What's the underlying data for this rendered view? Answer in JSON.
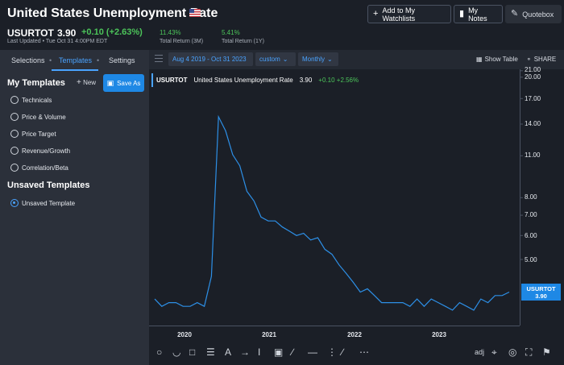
{
  "header": {
    "title": "United States Unemployment Rate",
    "ticker": "USURTOT",
    "price": "3.90",
    "change": "+0.10",
    "change_pct": "(+2.63%)",
    "last_updated": "Last Updated • Tue Oct 31 4:00PM EDT",
    "stats": [
      {
        "value": "11.43%",
        "label": "Total Return (3M)"
      },
      {
        "value": "5.41%",
        "label": "Total Return (1Y)"
      }
    ],
    "buttons": {
      "watchlist": "Add to My Watchlists",
      "notes": "My Notes",
      "quotebox": "Quotebox"
    }
  },
  "sidebar": {
    "tabs": [
      "Selections",
      "Templates",
      "Settings"
    ],
    "active_tab": "Templates",
    "my_templates_title": "My Templates",
    "new_label": "New",
    "save_as_label": "Save As",
    "templates": [
      "Technicals",
      "Price & Volume",
      "Price Target",
      "Revenue/Growth",
      "Correlation/Beta"
    ],
    "unsaved_title": "Unsaved Templates",
    "unsaved_items": [
      "Unsaved Template"
    ]
  },
  "toolbar": {
    "date_range": "Aug 4 2019 - Oct 31 2023",
    "range_mode": "custom",
    "frequency": "Monthly",
    "show_table": "Show Table",
    "share": "SHARE"
  },
  "legend": {
    "symbol": "USURTOT",
    "name": "United States Unemployment Rate",
    "value": "3.90",
    "change": "+0.10",
    "change_pct": "+2.56%"
  },
  "last_label": {
    "symbol": "USURTOT",
    "value": "3.90"
  },
  "bottom_tools": {
    "adj_label": "adj"
  },
  "colors": {
    "accent": "#1e88e5",
    "series": "#2d8fe6",
    "positive": "#4cc45a",
    "background": "#1b1f27",
    "panel": "#2b303a"
  },
  "chart_data": {
    "type": "line",
    "x_label_ticks": [
      "2020",
      "2021",
      "2022",
      "2023"
    ],
    "y_tick_labels": [
      "21.00",
      "20.00",
      "17.00",
      "14.00",
      "11.00",
      "8.00",
      "7.00",
      "6.00",
      "5.00"
    ],
    "y_scale": "log",
    "ylim": [
      3.0,
      21.0
    ],
    "xlim": [
      "2019-08",
      "2023-10"
    ],
    "series": [
      {
        "name": "USURTOT",
        "x": [
          "2019-08",
          "2019-09",
          "2019-10",
          "2019-11",
          "2019-12",
          "2020-01",
          "2020-02",
          "2020-03",
          "2020-04",
          "2020-05",
          "2020-06",
          "2020-07",
          "2020-08",
          "2020-09",
          "2020-10",
          "2020-11",
          "2020-12",
          "2021-01",
          "2021-02",
          "2021-03",
          "2021-04",
          "2021-05",
          "2021-06",
          "2021-07",
          "2021-08",
          "2021-09",
          "2021-10",
          "2021-11",
          "2021-12",
          "2022-01",
          "2022-02",
          "2022-03",
          "2022-04",
          "2022-05",
          "2022-06",
          "2022-07",
          "2022-08",
          "2022-09",
          "2022-10",
          "2022-11",
          "2022-12",
          "2023-01",
          "2023-02",
          "2023-03",
          "2023-04",
          "2023-05",
          "2023-06",
          "2023-07",
          "2023-08",
          "2023-09",
          "2023-10"
        ],
        "values": [
          3.7,
          3.5,
          3.6,
          3.6,
          3.5,
          3.5,
          3.6,
          3.5,
          4.4,
          14.8,
          13.3,
          11.1,
          10.2,
          8.4,
          7.8,
          6.9,
          6.7,
          6.7,
          6.4,
          6.2,
          6.0,
          6.1,
          5.8,
          5.9,
          5.4,
          5.2,
          4.8,
          4.5,
          4.2,
          3.9,
          4.0,
          3.8,
          3.6,
          3.6,
          3.6,
          3.6,
          3.5,
          3.7,
          3.5,
          3.7,
          3.6,
          3.5,
          3.4,
          3.6,
          3.5,
          3.4,
          3.7,
          3.6,
          3.8,
          3.8,
          3.9
        ]
      }
    ],
    "grid": false,
    "legend": "top-left"
  }
}
